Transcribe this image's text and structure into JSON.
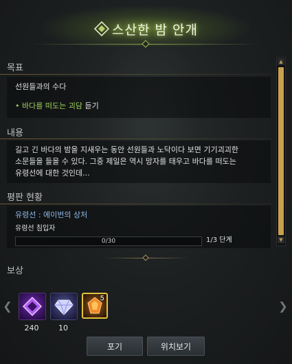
{
  "header": {
    "title": "스산한 밤 안개"
  },
  "goal": {
    "label": "목표",
    "task": "선원들과의 수다",
    "bullet": "• ",
    "objective_highlight": "바다를 떠도는 괴담",
    "objective_rest": " 듣기"
  },
  "content": {
    "label": "내용",
    "lines": [
      "길고 긴 바다의 밤을 지새우는 동안 선원들과 노닥이다 보면 기기괴괴한",
      "소문들을 들을 수 있다. 그중 제일은 역시 망자를 태우고 바다를 떠도는",
      "유령선에 대한 것인데..."
    ]
  },
  "reputation": {
    "label": "평판 현황",
    "faction": "유령선 : 에이번의 상처",
    "rank": "유령선 침입자",
    "progress_text": "0/30",
    "progress_fraction": 0,
    "stage": "1/3 단계"
  },
  "rewards": {
    "label": "보상",
    "items": [
      {
        "icon": "purple-gem-icon",
        "count": "240",
        "color": "#8a2be2"
      },
      {
        "icon": "crystal-icon",
        "count": "10",
        "color": "#b8b8ff"
      },
      {
        "icon": "orange-crystal-box-icon",
        "badge": "5",
        "color": "#e07a1f"
      }
    ]
  },
  "buttons": {
    "abandon": "포기",
    "locate": "위치보기"
  },
  "colors": {
    "accent_green": "#9fcf5a",
    "faction_blue": "#8fb8e8",
    "gold": "#caa04e"
  }
}
